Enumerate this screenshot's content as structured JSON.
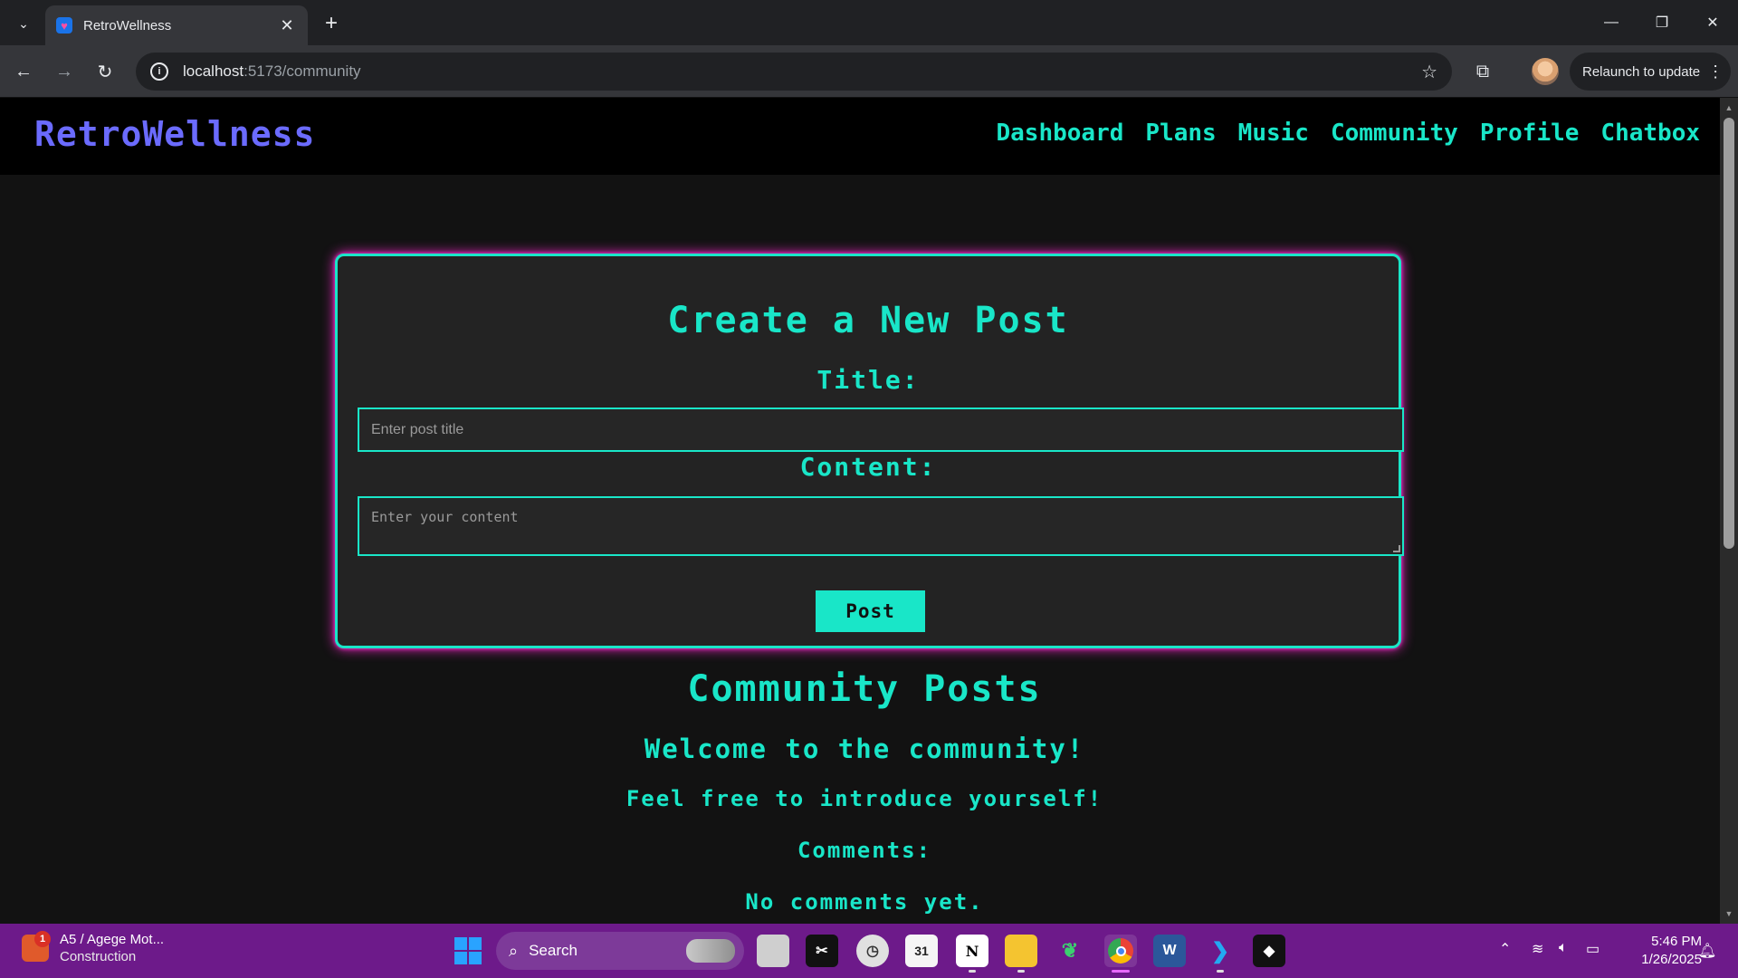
{
  "browser": {
    "tab_title": "RetroWellness",
    "url_host": "localhost",
    "url_path": ":5173/community",
    "relaunch_label": "Relaunch to update"
  },
  "site": {
    "brand": "RetroWellness",
    "nav": [
      "Dashboard",
      "Plans",
      "Music",
      "Community",
      "Profile",
      "Chatbox"
    ]
  },
  "form": {
    "heading": "Create a New Post",
    "title_label": "Title:",
    "title_placeholder": "Enter post title",
    "content_label": "Content:",
    "content_placeholder": "Enter your content",
    "submit_label": "Post"
  },
  "posts": {
    "heading": "Community Posts",
    "items": [
      {
        "title": "Welcome to the community!",
        "body": "Feel free to introduce yourself!",
        "comments_label": "Comments:",
        "no_comments": "No comments yet."
      }
    ]
  },
  "taskbar": {
    "news_badge": "1",
    "news_title": "A5 / Agege Mot...",
    "news_subtitle": "Construction",
    "search_label": "Search",
    "time": "5:46 PM",
    "date": "1/26/2025",
    "apps": [
      "file-manager-icon",
      "capcut-icon",
      "clock-app-icon",
      "calendar-icon",
      "notion-icon",
      "file-explorer-icon",
      "leaf-app-icon",
      "chrome-icon",
      "word-icon",
      "vscode-icon",
      "roblox-icon"
    ],
    "calendar_day": "31",
    "notion_letter": "N",
    "word_letter": "W"
  },
  "colors": {
    "accent": "#19e6c8",
    "brand": "#6b6bff",
    "glow": "#ff2bd1",
    "taskbar": "#6d1a8a"
  }
}
